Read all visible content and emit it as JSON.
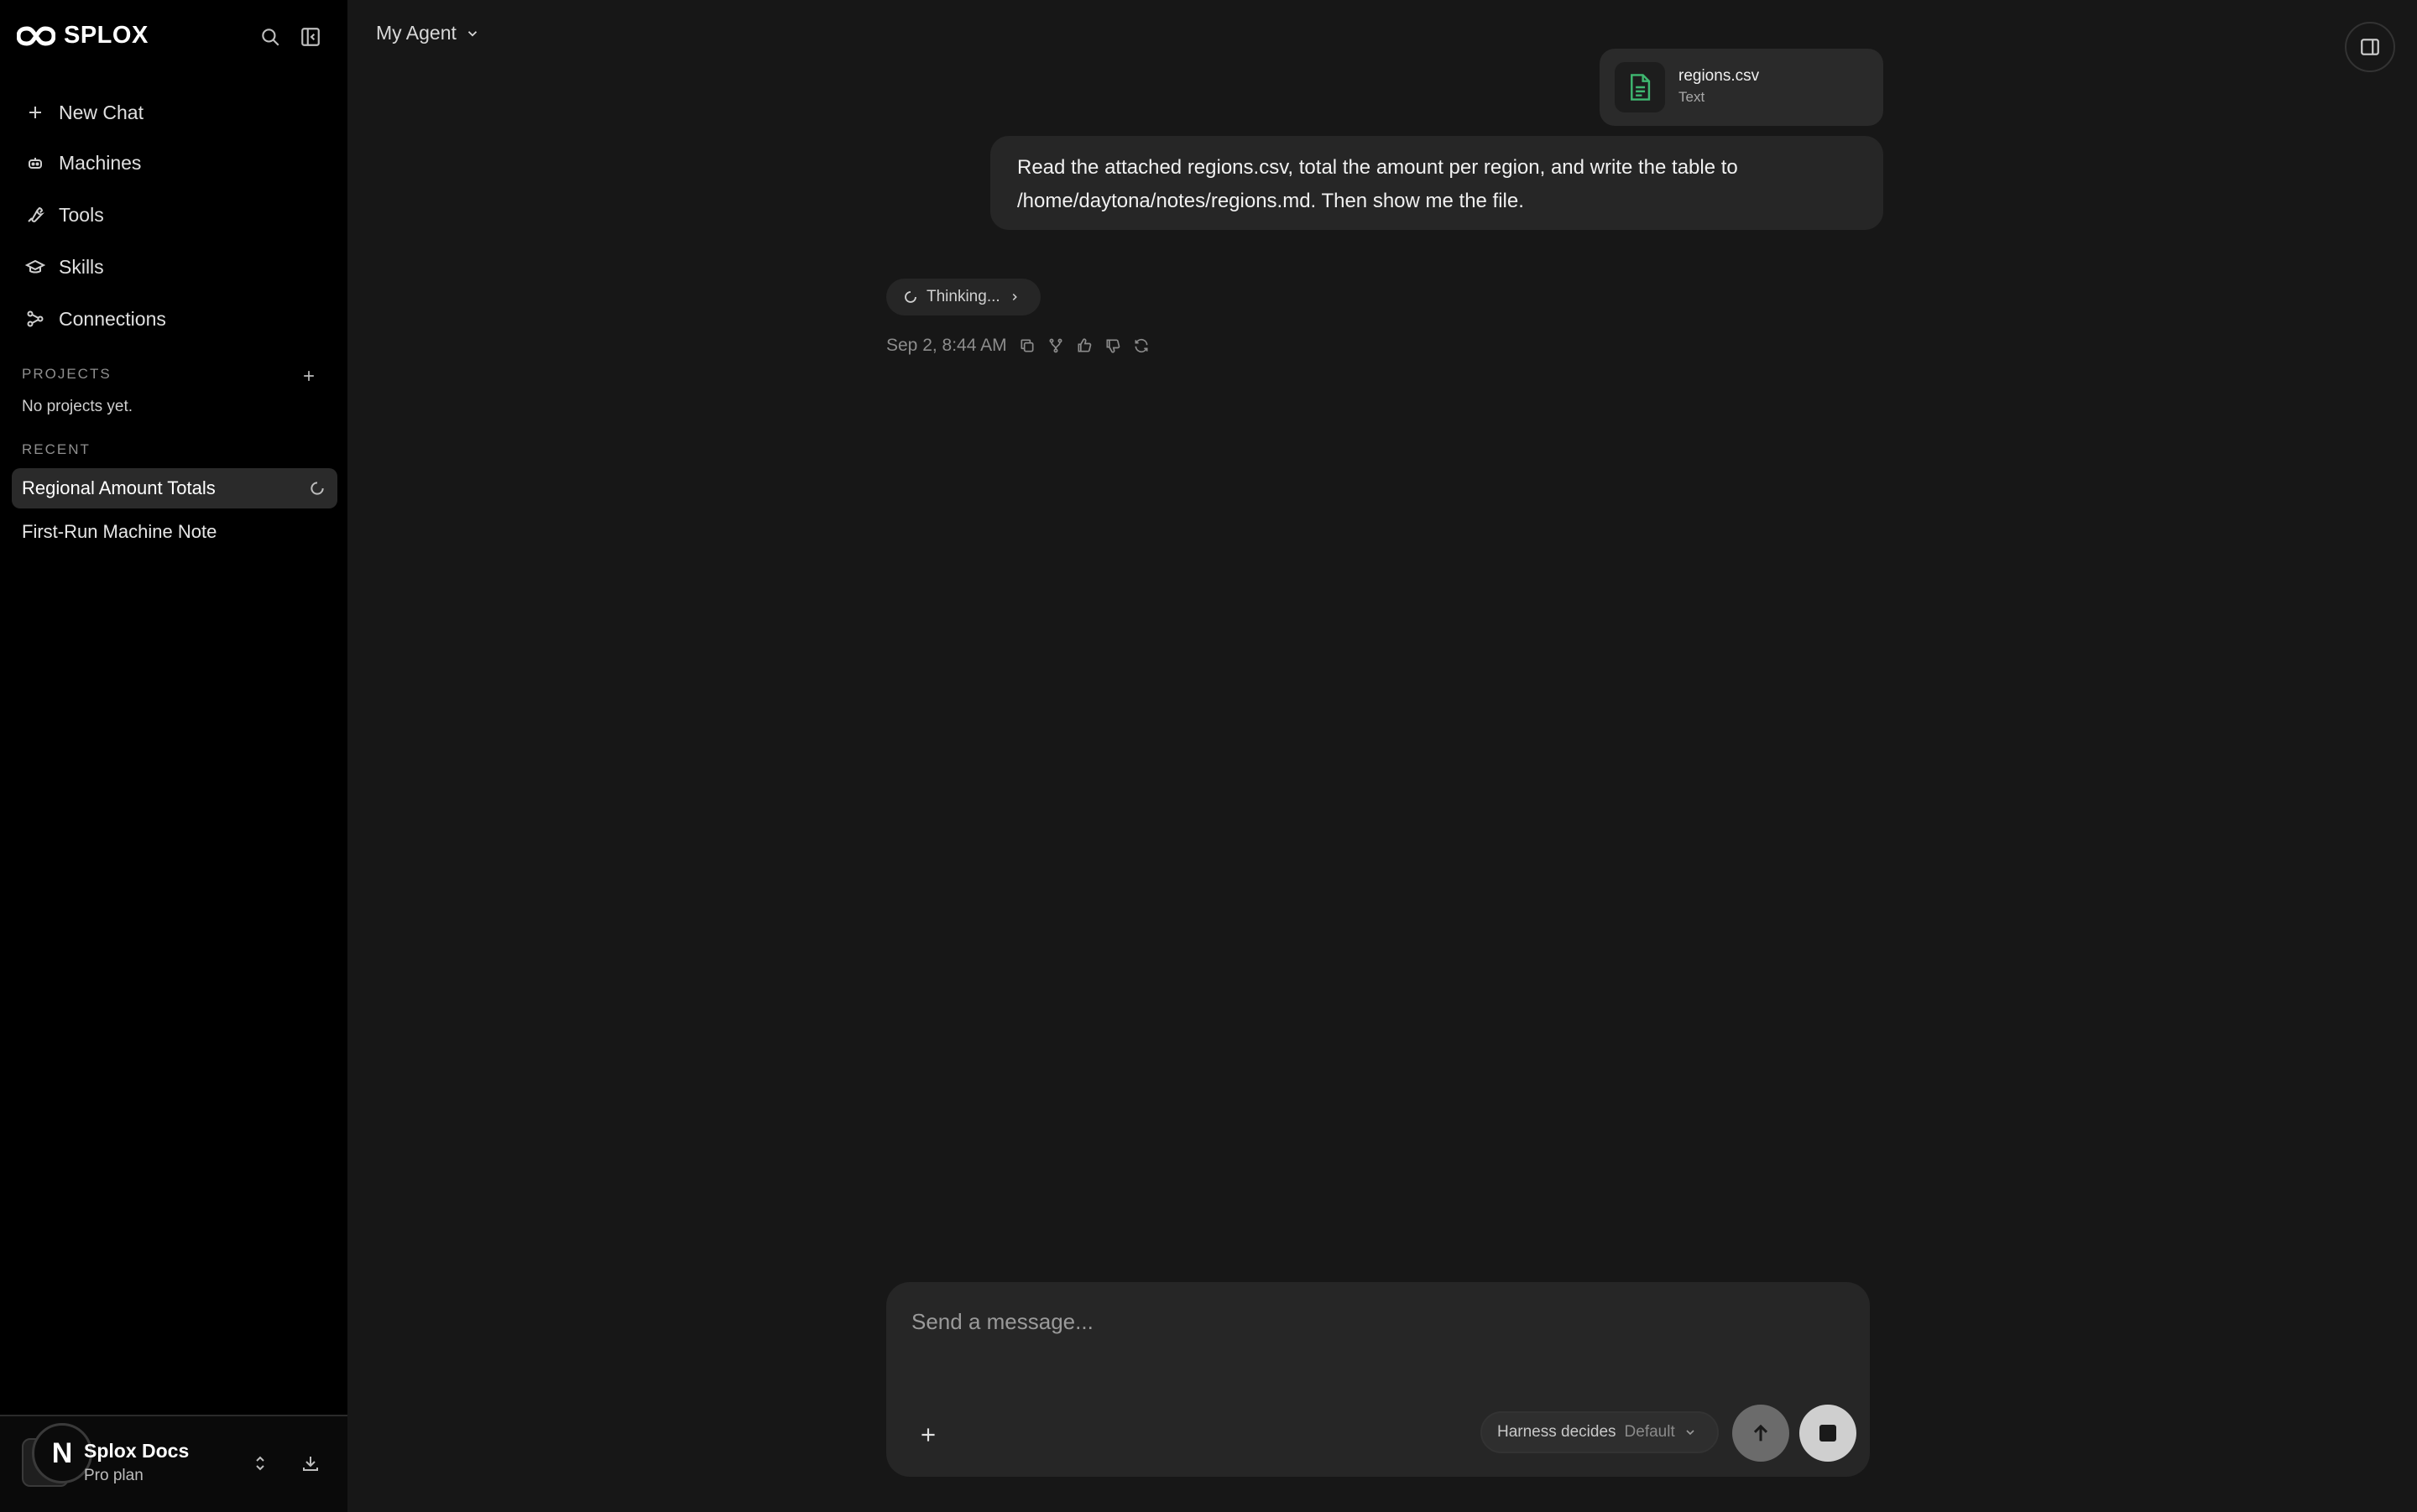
{
  "app": {
    "brand": "SPLOX"
  },
  "sidebar": {
    "nav": [
      {
        "label": "New Chat",
        "icon": "plus-icon"
      },
      {
        "label": "Machines",
        "icon": "robot-icon"
      },
      {
        "label": "Tools",
        "icon": "wrench-icon"
      },
      {
        "label": "Skills",
        "icon": "graduation-cap-icon"
      },
      {
        "label": "Connections",
        "icon": "connections-icon"
      }
    ],
    "projects_label": "PROJECTS",
    "projects_empty": "No projects yet.",
    "recent_label": "RECENT",
    "recent": [
      {
        "label": "Regional Amount Totals",
        "active": true
      },
      {
        "label": "First-Run Machine Note",
        "active": false
      }
    ],
    "workspace": {
      "avatar_letter": "N",
      "name": "Splox Docs",
      "plan": "Pro plan"
    }
  },
  "header": {
    "agent": "My Agent"
  },
  "conversation": {
    "attachment": {
      "name": "regions.csv",
      "type": "Text"
    },
    "user_message": "Read the attached regions.csv, total the amount per region, and write the table to /home/daytona/notes/regions.md. Then show me the file.",
    "thinking": "Thinking...",
    "timestamp": "Sep 2, 8:44 AM"
  },
  "composer": {
    "placeholder": "Send a message...",
    "harness_label": "Harness decides",
    "harness_value": "Default"
  },
  "colors": {
    "background": "#171717",
    "sidebar": "#000000",
    "file_icon": "#3fb871"
  }
}
